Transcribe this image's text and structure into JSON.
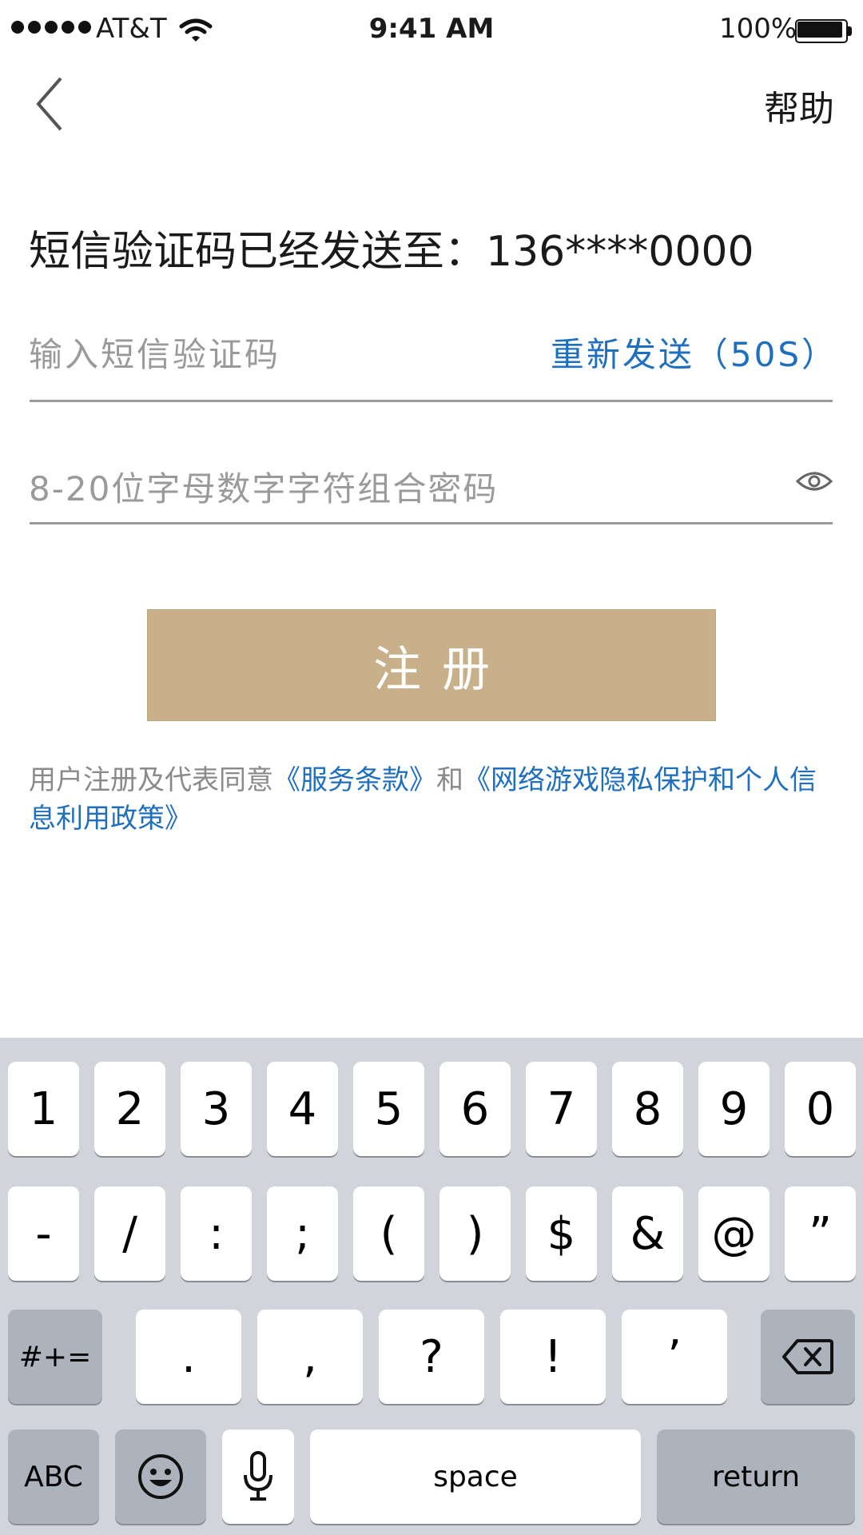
{
  "status_bar": {
    "carrier": "AT&T",
    "time": "9:41 AM",
    "battery": "100%",
    "battery_level": 1.0
  },
  "nav": {
    "back_icon": "chevron-left-icon",
    "help_label": "帮助"
  },
  "main": {
    "sent_prefix": "短信验证码已经发送至：",
    "phone": "136****0000",
    "code_placeholder": "输入短信验证码",
    "resend_label": "重新发送（50S）",
    "password_placeholder": "8-20位字母数字字符组合密码",
    "password_toggle_icon": "eye-icon",
    "register_label": "注册",
    "terms": {
      "prefix": "用户注册及代表同意",
      "link1": "《服务条款》",
      "middle": "和",
      "link2": "《网络游戏隐私保护和个人信息利用政策》"
    }
  },
  "colors": {
    "accent_link": "#1f6fbf",
    "register_button": "#c8b08b",
    "keyboard_bg": "#d1d5db"
  },
  "keyboard": {
    "row1": [
      "1",
      "2",
      "3",
      "4",
      "5",
      "6",
      "7",
      "8",
      "9",
      "0"
    ],
    "row2": [
      "-",
      "/",
      ":",
      ";",
      "(",
      ")",
      "$",
      "&",
      "@",
      "”"
    ],
    "row3": {
      "mode": "#+=",
      "keys": [
        ".",
        ",",
        "?",
        "!",
        "’"
      ],
      "delete_icon": "backspace-icon"
    },
    "row4": {
      "abc": "ABC",
      "emoji_icon": "emoji-icon",
      "mic_icon": "microphone-icon",
      "space": "space",
      "return": "return"
    }
  }
}
